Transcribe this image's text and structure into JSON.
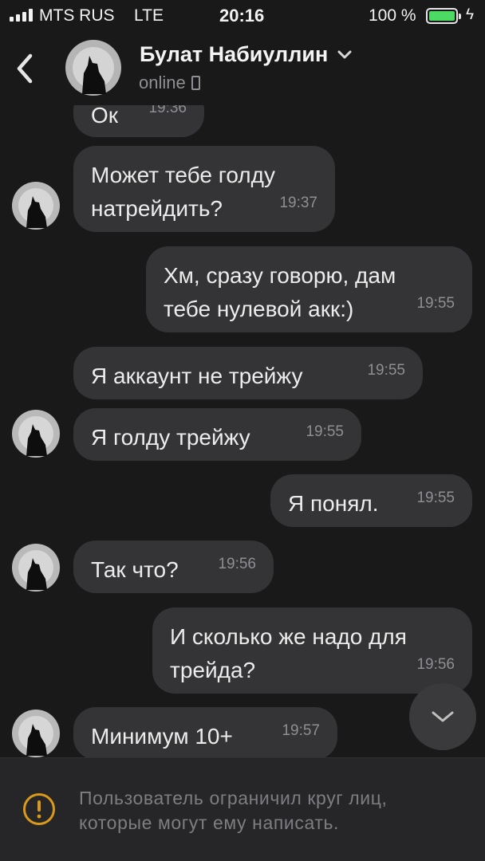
{
  "status_bar": {
    "carrier": "MTS RUS",
    "network": "LTE",
    "time": "20:16",
    "battery": "100 %"
  },
  "header": {
    "name": "Булат Набиуллин",
    "status": "online"
  },
  "messages": [
    {
      "text": "Ок",
      "time": "19:36",
      "side": "in"
    },
    {
      "text": "Может тебе голду\nнатрейдить?",
      "time": "19:37",
      "side": "in"
    },
    {
      "text": "Хм, сразу говорю, дам\nтебе нулевой акк:)",
      "time": "19:55",
      "side": "out"
    },
    {
      "text": "Я аккаунт не трейжу",
      "time": "19:55",
      "side": "in"
    },
    {
      "text": "Я голду трейжу",
      "time": "19:55",
      "side": "in"
    },
    {
      "text": "Я понял.",
      "time": "19:55",
      "side": "out"
    },
    {
      "text": "Так что?",
      "time": "19:56",
      "side": "in"
    },
    {
      "text": "И сколько же надо для\nтрейда?",
      "time": "19:56",
      "side": "out"
    },
    {
      "text": "Минимум 10+",
      "time": "19:57",
      "side": "in"
    }
  ],
  "notice": {
    "text": "Пользователь ограничил круг лиц,\nкоторые могут ему написать."
  },
  "colors": {
    "background": "#19191a",
    "bubble": "#343436",
    "warning": "#d99a1a",
    "battery": "#4cd964"
  },
  "icons": {
    "back": "chevron-left-icon",
    "dropdown": "chevron-down-icon",
    "device": "phone-icon",
    "scroll": "chevron-down-icon",
    "warning": "warning-circle-icon"
  }
}
